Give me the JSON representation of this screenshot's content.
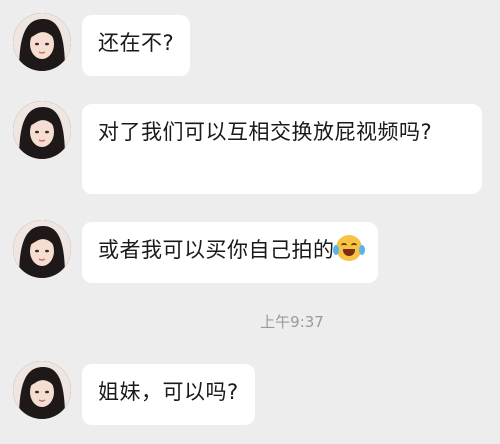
{
  "messages": [
    {
      "text": "还在不?",
      "emoji": ""
    },
    {
      "text": "对了我们可以互相交换放屁视频吗?",
      "emoji": ""
    },
    {
      "text": "或者我可以买你自己拍的",
      "emoji": "face-with-tears-of-joy-icon"
    },
    {
      "text": "姐妹，可以吗?",
      "emoji": ""
    }
  ],
  "timestamp": "上午9:37",
  "colors": {
    "background": "#ededed",
    "bubble": "#ffffff",
    "text": "#1a1a1a",
    "time": "#9a9a9a"
  }
}
